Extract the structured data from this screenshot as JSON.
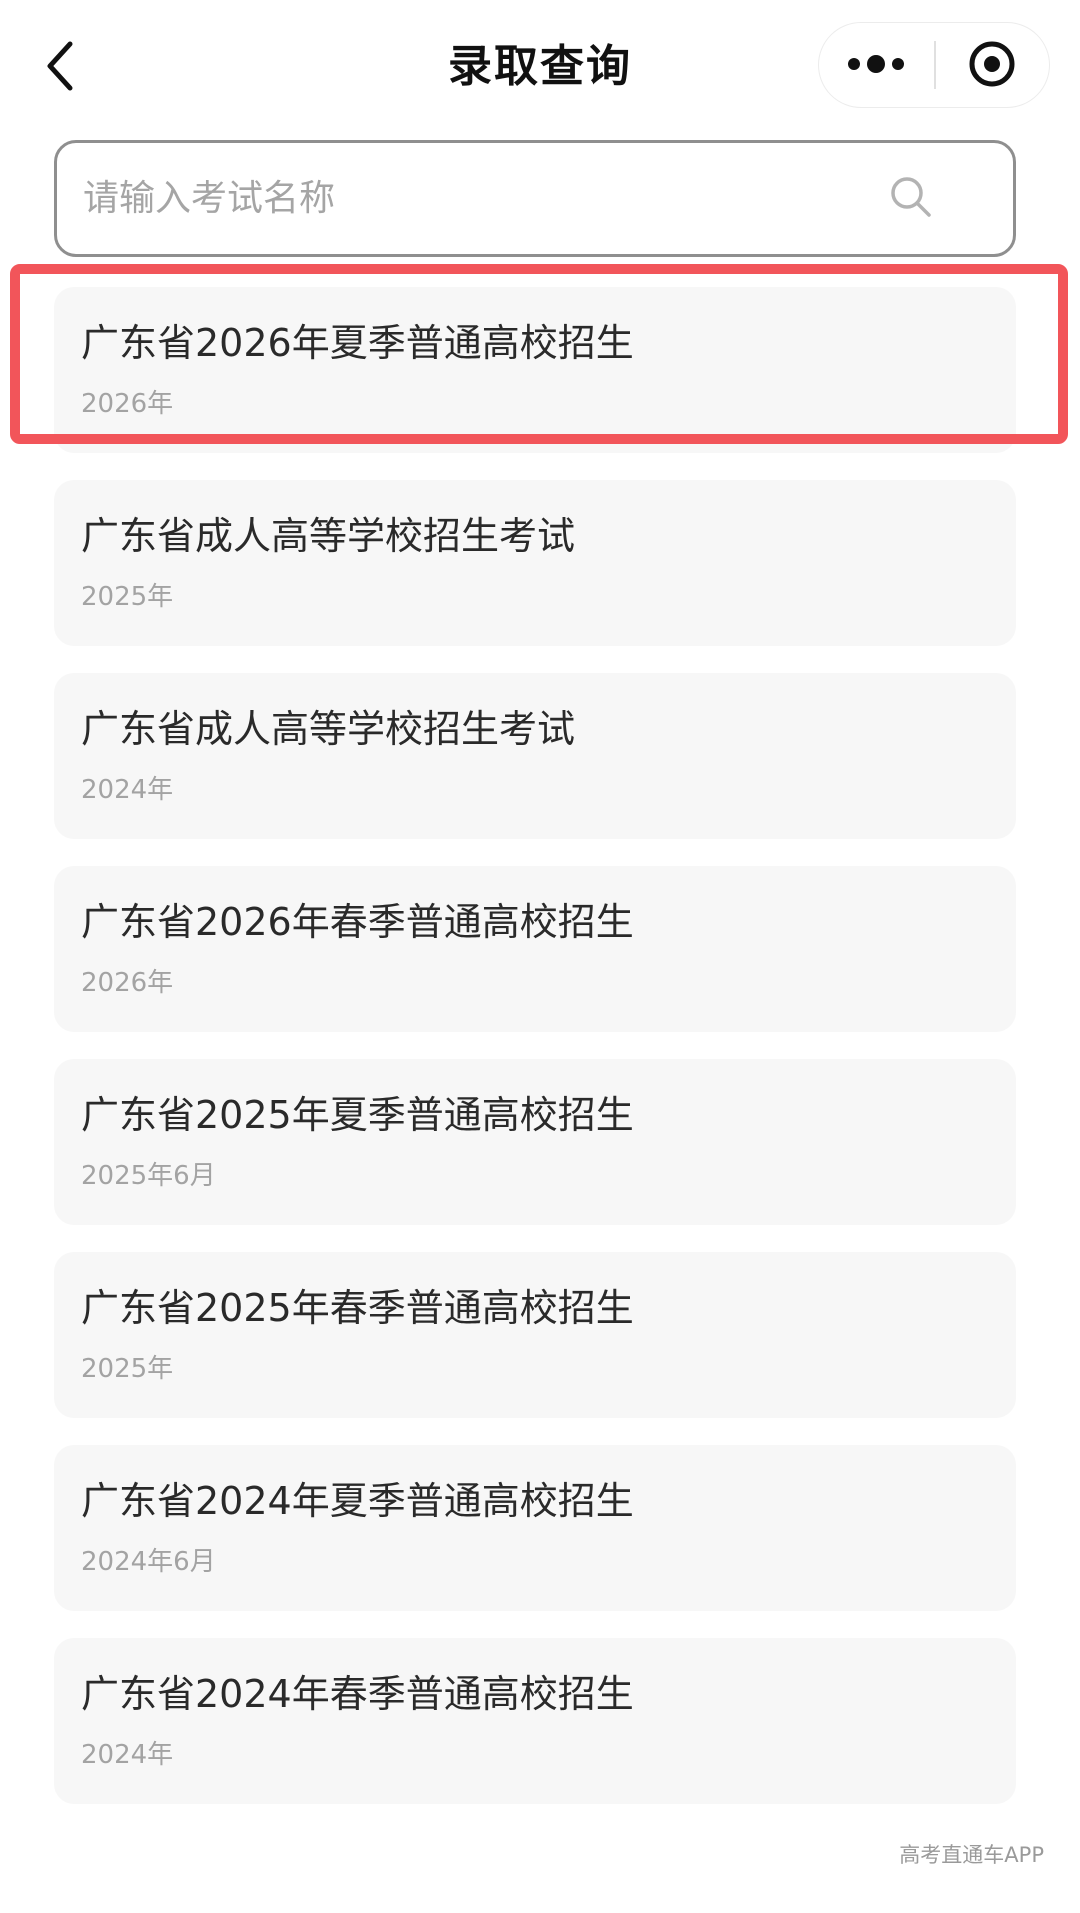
{
  "header": {
    "title": "录取查询",
    "back_icon": "chevron-left-icon",
    "more_icon": "more-dots-icon",
    "close_icon": "target-close-icon"
  },
  "search": {
    "placeholder": "请输入考试名称",
    "value": "",
    "icon": "search-icon"
  },
  "exams": [
    {
      "title": "广东省2026年夏季普通高校招生",
      "date": "2026年"
    },
    {
      "title": "广东省成人高等学校招生考试",
      "date": "2025年"
    },
    {
      "title": "广东省成人高等学校招生考试",
      "date": "2024年"
    },
    {
      "title": "广东省2026年春季普通高校招生",
      "date": "2026年"
    },
    {
      "title": "广东省2025年夏季普通高校招生",
      "date": "2025年6月"
    },
    {
      "title": "广东省2025年春季普通高校招生",
      "date": "2025年"
    },
    {
      "title": "广东省2024年夏季普通高校招生",
      "date": "2024年6月"
    },
    {
      "title": "广东省2024年春季普通高校招生",
      "date": "2024年"
    }
  ],
  "highlight": {
    "target": "exams.0",
    "color": "#f2555a"
  },
  "colors": {
    "card_background": "#f7f7f7",
    "title_text": "#2a2a2a",
    "date_text": "#a3a3a3",
    "search_border": "#8f8f8f"
  },
  "watermark": "高考直通车APP"
}
